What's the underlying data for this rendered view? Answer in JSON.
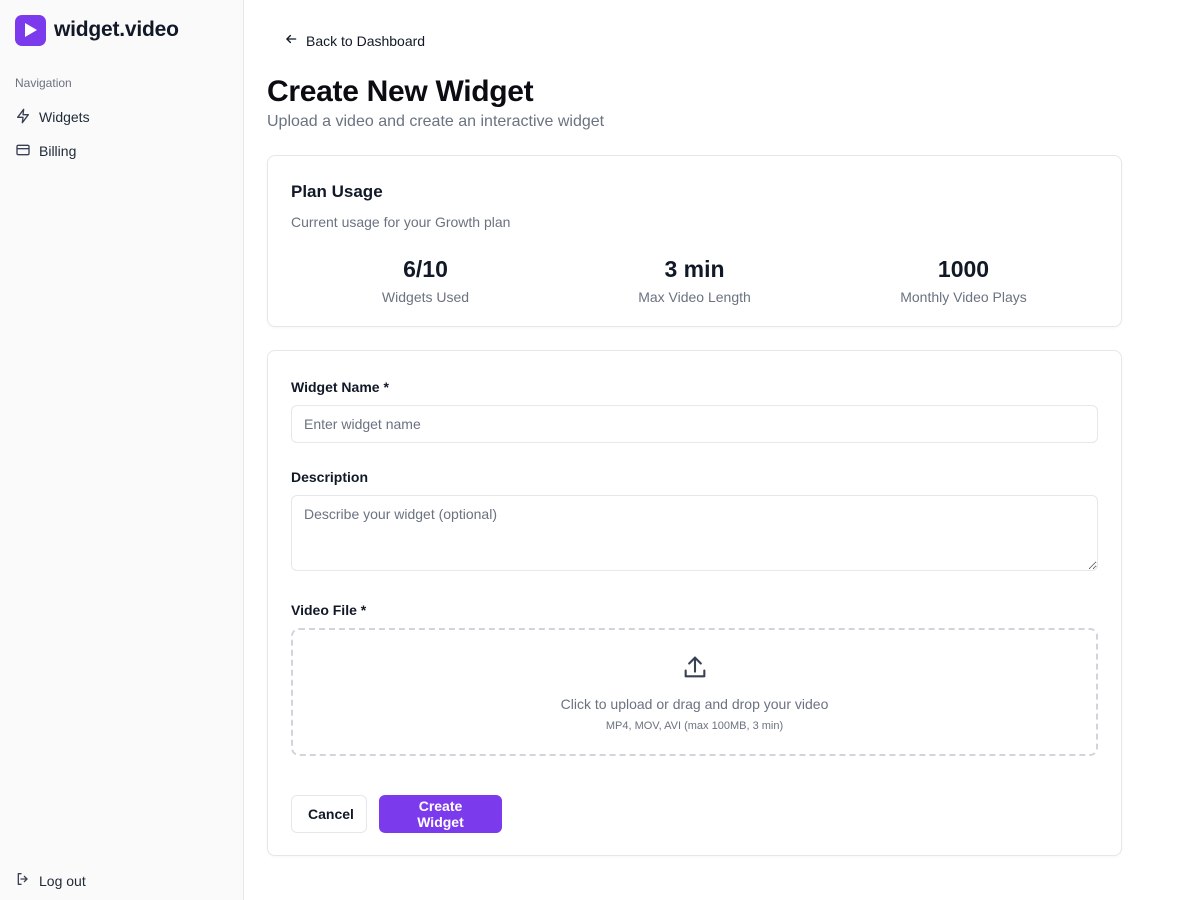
{
  "app": {
    "name": "widget.video",
    "accent": "#7c3aed"
  },
  "sidebar": {
    "heading": "Navigation",
    "items": [
      {
        "label": "Widgets",
        "icon": "lightning-icon"
      },
      {
        "label": "Billing",
        "icon": "credit-card-icon"
      }
    ],
    "logout_label": "Log out"
  },
  "header": {
    "back_label": "Back to Dashboard",
    "title": "Create New Widget",
    "subtitle": "Upload a video and create an interactive widget"
  },
  "usage": {
    "title": "Plan Usage",
    "subtitle": "Current usage for your Growth plan",
    "stats": [
      {
        "value": "6/10",
        "label": "Widgets Used"
      },
      {
        "value": "3 min",
        "label": "Max Video Length"
      },
      {
        "value": "1000",
        "label": "Monthly Video Plays"
      }
    ]
  },
  "form": {
    "name_label": "Widget Name *",
    "name_placeholder": "Enter widget name",
    "name_value": "",
    "description_label": "Description",
    "description_placeholder": "Describe your widget (optional)",
    "description_value": "",
    "video_label": "Video File *",
    "upload_text": "Click to upload or drag and drop your video",
    "upload_hint": "MP4, MOV, AVI (max 100MB, 3 min)",
    "cancel_label": "Cancel",
    "submit_label": "Create Widget"
  }
}
